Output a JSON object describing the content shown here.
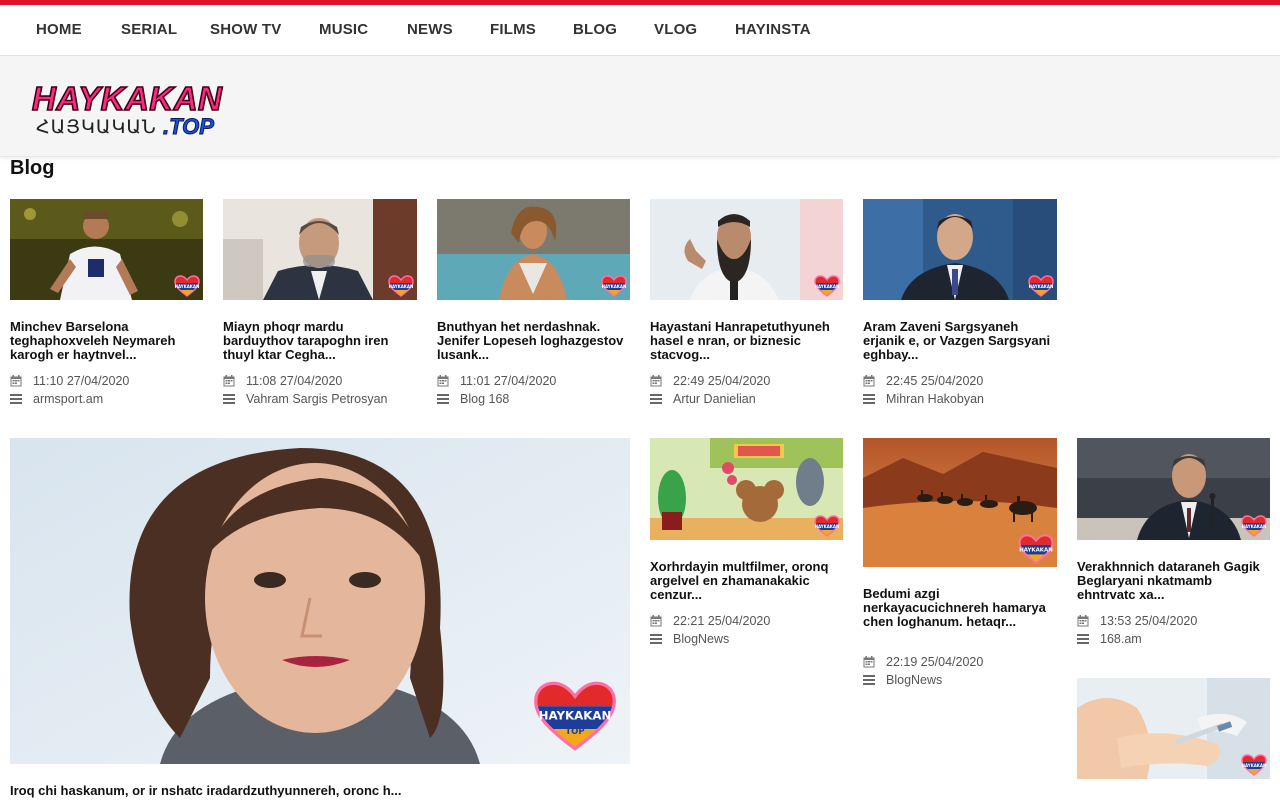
{
  "nav": {
    "items": [
      "HOME",
      "SERIAL",
      "SHOW TV",
      "MUSIC",
      "NEWS",
      "FILMS",
      "BLOG",
      "VLOG",
      "HAYINSTA"
    ]
  },
  "logo": {
    "text_top": "HAYKAKAN",
    "text_bottom_arm": "ՀԱՅԿԱԿԱՆ",
    "text_bottom_top": ".TOP"
  },
  "badge_text": {
    "top": "HAYKAKAN",
    "bottom": "TOP"
  },
  "section": {
    "title": "Blog"
  },
  "colors": {
    "accent": "#e0112b",
    "logo_pink": "#ff2a7f",
    "logo_blue": "#1d4fe0"
  },
  "icons": {
    "date": "calendar-icon",
    "source": "list-icon"
  },
  "posts": [
    {
      "title": "Minchev Barselona teghaphoxveleh Neymareh karogh er haytnvel...",
      "time": "11:10 27/04/2020",
      "source": "armsport.am"
    },
    {
      "title": "Miayn phoqr mardu barduythov tarapoghn iren thuyl ktar Cegha...",
      "time": "11:08 27/04/2020",
      "source": "Vahram Sargis Petrosyan"
    },
    {
      "title": "Bnuthyan het nerdashnak. Jenifer Lopeseh loghazgestov lusank...",
      "time": "11:01 27/04/2020",
      "source": "Blog 168"
    },
    {
      "title": "Hayastani Hanrapetuthyuneh hasel e nran, or biznesic stacvog...",
      "time": "22:49 25/04/2020",
      "source": "Artur Danielian"
    },
    {
      "title": "Aram Zaveni Sargsyaneh erjanik e, or Vazgen Sargsyani eghbay...",
      "time": "22:45 25/04/2020",
      "source": "Mihran Hakobyan"
    },
    {
      "title": "Iroq chi haskanum, or ir nshatc iradardzuthyunnereh, oronc h..."
    },
    {
      "title": "Xorhrdayin multfilmer, oronq argelvel en zhamanakakic cenzur...",
      "time": "22:21 25/04/2020",
      "source": "BlogNews"
    },
    {
      "title": "Bedumi azgi nerkayacucichnereh hamarya chen loghanum. hetaqr...",
      "time": "22:19 25/04/2020",
      "source": "BlogNews"
    },
    {
      "title": "Verakhnnich dataraneh Gagik Beglaryani nkatmamb ehntrvatc xa...",
      "time": "13:53 25/04/2020",
      "source": "168.am"
    },
    {
      "title": ""
    }
  ]
}
